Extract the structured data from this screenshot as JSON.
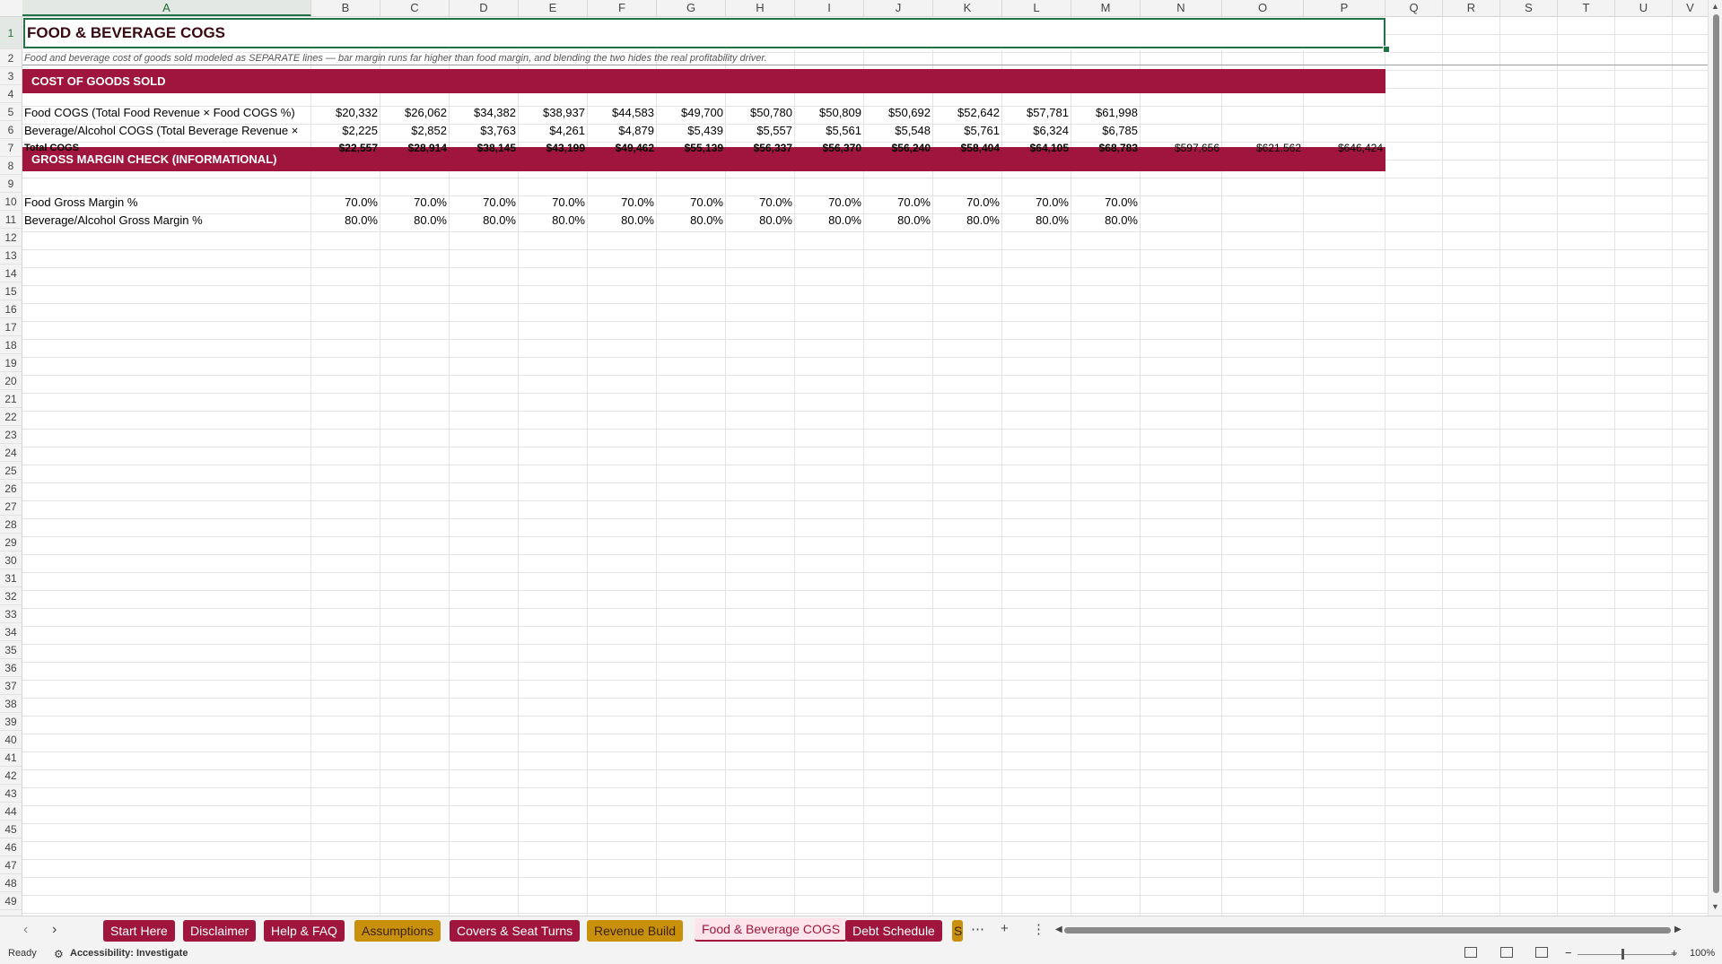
{
  "columns": [
    "A",
    "B",
    "C",
    "D",
    "E",
    "F",
    "G",
    "H",
    "I",
    "J",
    "K",
    "L",
    "M",
    "N",
    "O",
    "P",
    "Q",
    "R",
    "S",
    "T",
    "U",
    "V"
  ],
  "selected_column": "A",
  "rows_visible": 49,
  "selected_row": 1,
  "title": "FOOD & BEVERAGE COGS",
  "subtitle": "Food and beverage cost of goods sold modeled as SEPARATE lines — bar margin runs far higher than food margin, and blending the two hides the real profitability driver.",
  "sections": {
    "cogs_header": "COST OF GOODS SOLD",
    "margin_header": "GROSS MARGIN CHECK (INFORMATIONAL)"
  },
  "rows": {
    "food_cogs": {
      "label": "Food COGS (Total Food Revenue × Food COGS %)",
      "values": [
        "$20,332",
        "$26,062",
        "$34,382",
        "$38,937",
        "$44,583",
        "$49,700",
        "$50,780",
        "$50,809",
        "$50,692",
        "$52,642",
        "$57,781",
        "$61,998"
      ]
    },
    "bev_cogs": {
      "label": "Beverage/Alcohol COGS (Total Beverage Revenue ×",
      "values": [
        "$2,225",
        "$2,852",
        "$3,763",
        "$4,261",
        "$4,879",
        "$5,439",
        "$5,557",
        "$5,561",
        "$5,548",
        "$5,761",
        "$6,324",
        "$6,785"
      ]
    },
    "total_cogs": {
      "label": "Total COGS",
      "values": [
        "$22,557",
        "$28,914",
        "$38,145",
        "$43,199",
        "$49,462",
        "$55,139",
        "$56,337",
        "$56,370",
        "$56,240",
        "$58,404",
        "$64,105",
        "$68,783",
        "$597,656",
        "$621,562",
        "$646,424"
      ]
    },
    "food_margin": {
      "label": "Food Gross Margin %",
      "values": [
        "70.0%",
        "70.0%",
        "70.0%",
        "70.0%",
        "70.0%",
        "70.0%",
        "70.0%",
        "70.0%",
        "70.0%",
        "70.0%",
        "70.0%",
        "70.0%"
      ]
    },
    "bev_margin": {
      "label": "Beverage/Alcohol Gross Margin %",
      "values": [
        "80.0%",
        "80.0%",
        "80.0%",
        "80.0%",
        "80.0%",
        "80.0%",
        "80.0%",
        "80.0%",
        "80.0%",
        "80.0%",
        "80.0%",
        "80.0%"
      ]
    }
  },
  "sheet_tabs": [
    {
      "label": "Start Here",
      "style": "red"
    },
    {
      "label": "Disclaimer",
      "style": "red"
    },
    {
      "label": "Help & FAQ",
      "style": "red"
    },
    {
      "label": "Assumptions",
      "style": "gold"
    },
    {
      "label": "Covers & Seat Turns",
      "style": "red"
    },
    {
      "label": "Revenue Build",
      "style": "gold"
    },
    {
      "label": "Food & Beverage COGS",
      "style": "active"
    },
    {
      "label": "Debt Schedule",
      "style": "red"
    },
    {
      "label": "S",
      "style": "gold"
    }
  ],
  "tab_controls": {
    "more": "⋯",
    "add": "+",
    "options": "⋮"
  },
  "status": {
    "ready": "Ready",
    "accessibility": "Accessibility: Investigate",
    "zoom": "100%",
    "zoom_minus": "−",
    "zoom_plus": "+"
  },
  "colors": {
    "section_band": "#a0153e",
    "gold_tab": "#c9900c",
    "selection": "#217346"
  }
}
